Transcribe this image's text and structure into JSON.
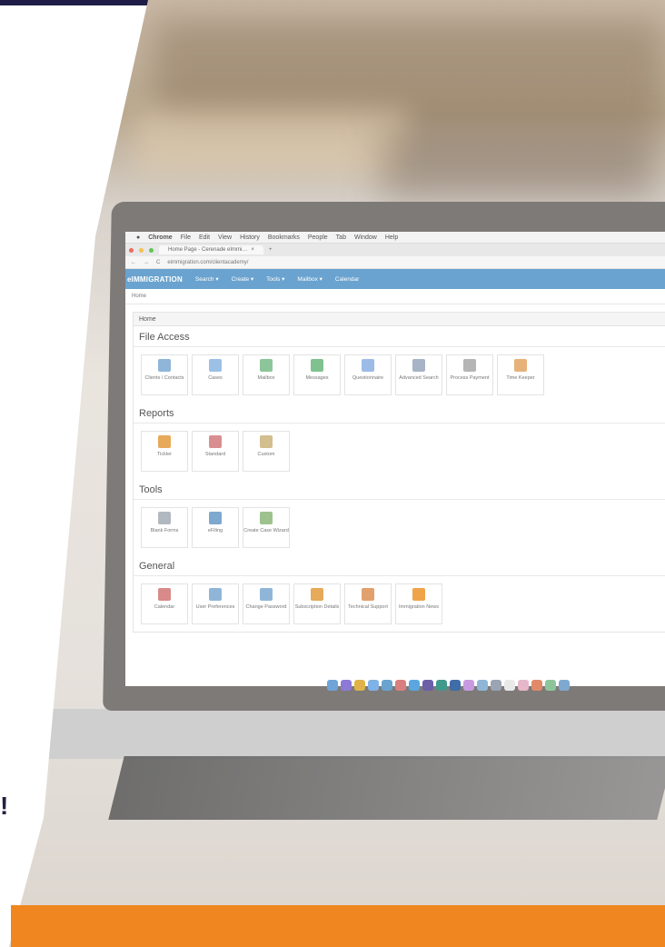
{
  "app_menu": {
    "apple": "",
    "items": [
      "Chrome",
      "File",
      "Edit",
      "View",
      "History",
      "Bookmarks",
      "People",
      "Tab",
      "Window",
      "Help"
    ]
  },
  "browser": {
    "tab_title": "Home Page - Cerenade eImmi…",
    "url": "eimmigration.com/clientacademy/"
  },
  "navbar": {
    "brand": "eIMMIGRATION",
    "items": [
      "Search ▾",
      "Create ▾",
      "Tools ▾",
      "Mailbox ▾",
      "Calendar"
    ]
  },
  "breadcrumb": "Home",
  "panel_title": "Home",
  "sections": [
    {
      "title": "File Access",
      "tiles": [
        "Clients / Contacts",
        "Cases",
        "Mailbox",
        "Messages",
        "Questionnaire",
        "Advanced Search",
        "Process Payment",
        "Time Keeper"
      ]
    },
    {
      "title": "Reports",
      "tiles": [
        "Tickler",
        "Standard",
        "Custom"
      ]
    },
    {
      "title": "Tools",
      "tiles": [
        "Blank Forms",
        "eFiling",
        "Create Case Wizard"
      ]
    },
    {
      "title": "General",
      "tiles": [
        "Calendar",
        "User Preferences",
        "Change Password",
        "Subscription Details",
        "Technical Support",
        "Immigration News"
      ]
    }
  ],
  "left_mark": "!",
  "colors": {
    "accent": "#f0861f",
    "topbar": "#1f1d47",
    "nav": "#6aa3cf"
  }
}
